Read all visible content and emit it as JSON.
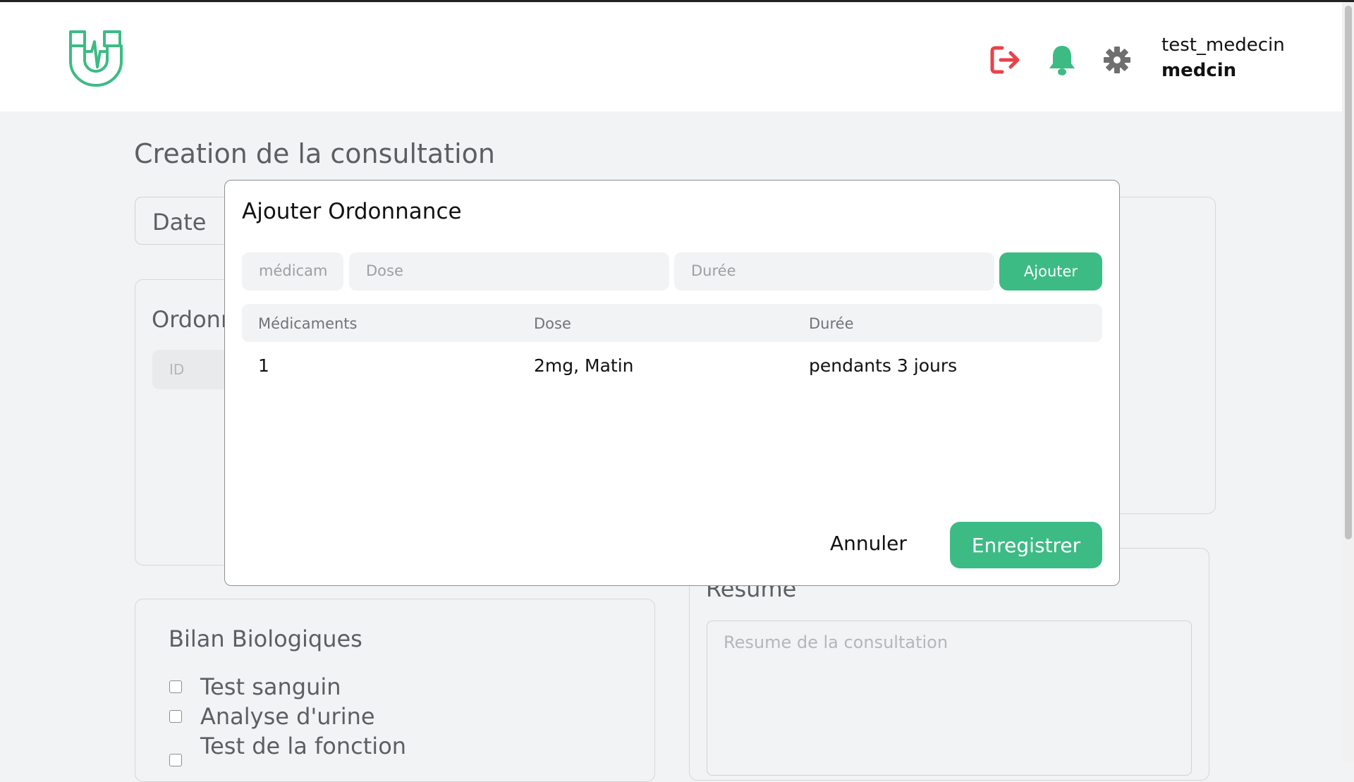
{
  "header": {
    "user_name": "test_medecin",
    "user_role": "medcin",
    "icons": [
      "logout-icon",
      "bell-icon",
      "gear-icon"
    ],
    "colors": {
      "accent": "#3dbb85",
      "logout": "#e8434a",
      "settings": "#6f6f6f"
    }
  },
  "page": {
    "title": "Creation de la consultation",
    "date_label": "Date",
    "ordonnance_label": "Ordonn",
    "id_placeholder": "ID",
    "bilan": {
      "title": "Bilan Biologiques",
      "items": [
        "Test sanguin",
        "Analyse d'urine",
        "Test de la fonction"
      ]
    },
    "resume": {
      "title": "Resume",
      "placeholder": "Resume de la consultation"
    }
  },
  "modal": {
    "title": "Ajouter Ordonnance",
    "inputs": {
      "medicament_placeholder": "médicam",
      "dose_placeholder": "Dose",
      "duree_placeholder": "Durée"
    },
    "add_label": "Ajouter",
    "table": {
      "headers": [
        "Médicaments",
        "Dose",
        "Durée"
      ],
      "rows": [
        {
          "medicament": "1",
          "dose": "2mg, Matin",
          "duree": "pendants 3 jours"
        }
      ]
    },
    "cancel_label": "Annuler",
    "save_label": "Enregistrer"
  }
}
